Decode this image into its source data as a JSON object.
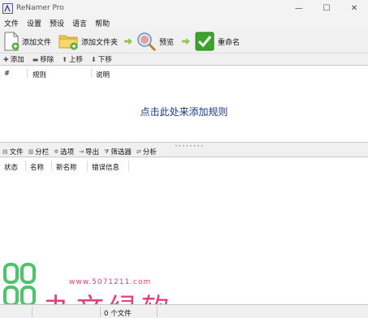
{
  "window": {
    "title": "ReNamer Pro",
    "minimize_glyph": "—",
    "maximize_glyph": "☐",
    "close_glyph": "✕"
  },
  "menu": [
    "文件",
    "设置",
    "预设",
    "语言",
    "帮助"
  ],
  "toolbar": {
    "add_files": "添加文件",
    "add_folders": "添加文件夹",
    "preview": "预览",
    "rename": "重命名"
  },
  "rules_toolbar": {
    "add": "添加",
    "remove": "移除",
    "move_up": "上移",
    "move_down": "下移"
  },
  "rules_table": {
    "columns": [
      "#",
      "规则",
      "说明"
    ],
    "empty_hint": "点击此处来添加规则"
  },
  "files_toolbar": {
    "files": "文件",
    "columns": "分栏",
    "options": "选项",
    "export": "导出",
    "filter": "筛选器",
    "analyze": "分析"
  },
  "files_table": {
    "columns": [
      "状态",
      "名称",
      "新名称",
      "错误信息"
    ]
  },
  "status_bar": {
    "file_count": "0 个文件"
  },
  "watermark": {
    "url": "www.5071211.com",
    "text": "办文绿软"
  },
  "colors": {
    "link_blue": "#1a3a8a",
    "arrow_green": "#5ab03a",
    "rename_green": "#3aa52a",
    "watermark_pink": "#e0407a",
    "watermark_green": "#4cc46a"
  }
}
